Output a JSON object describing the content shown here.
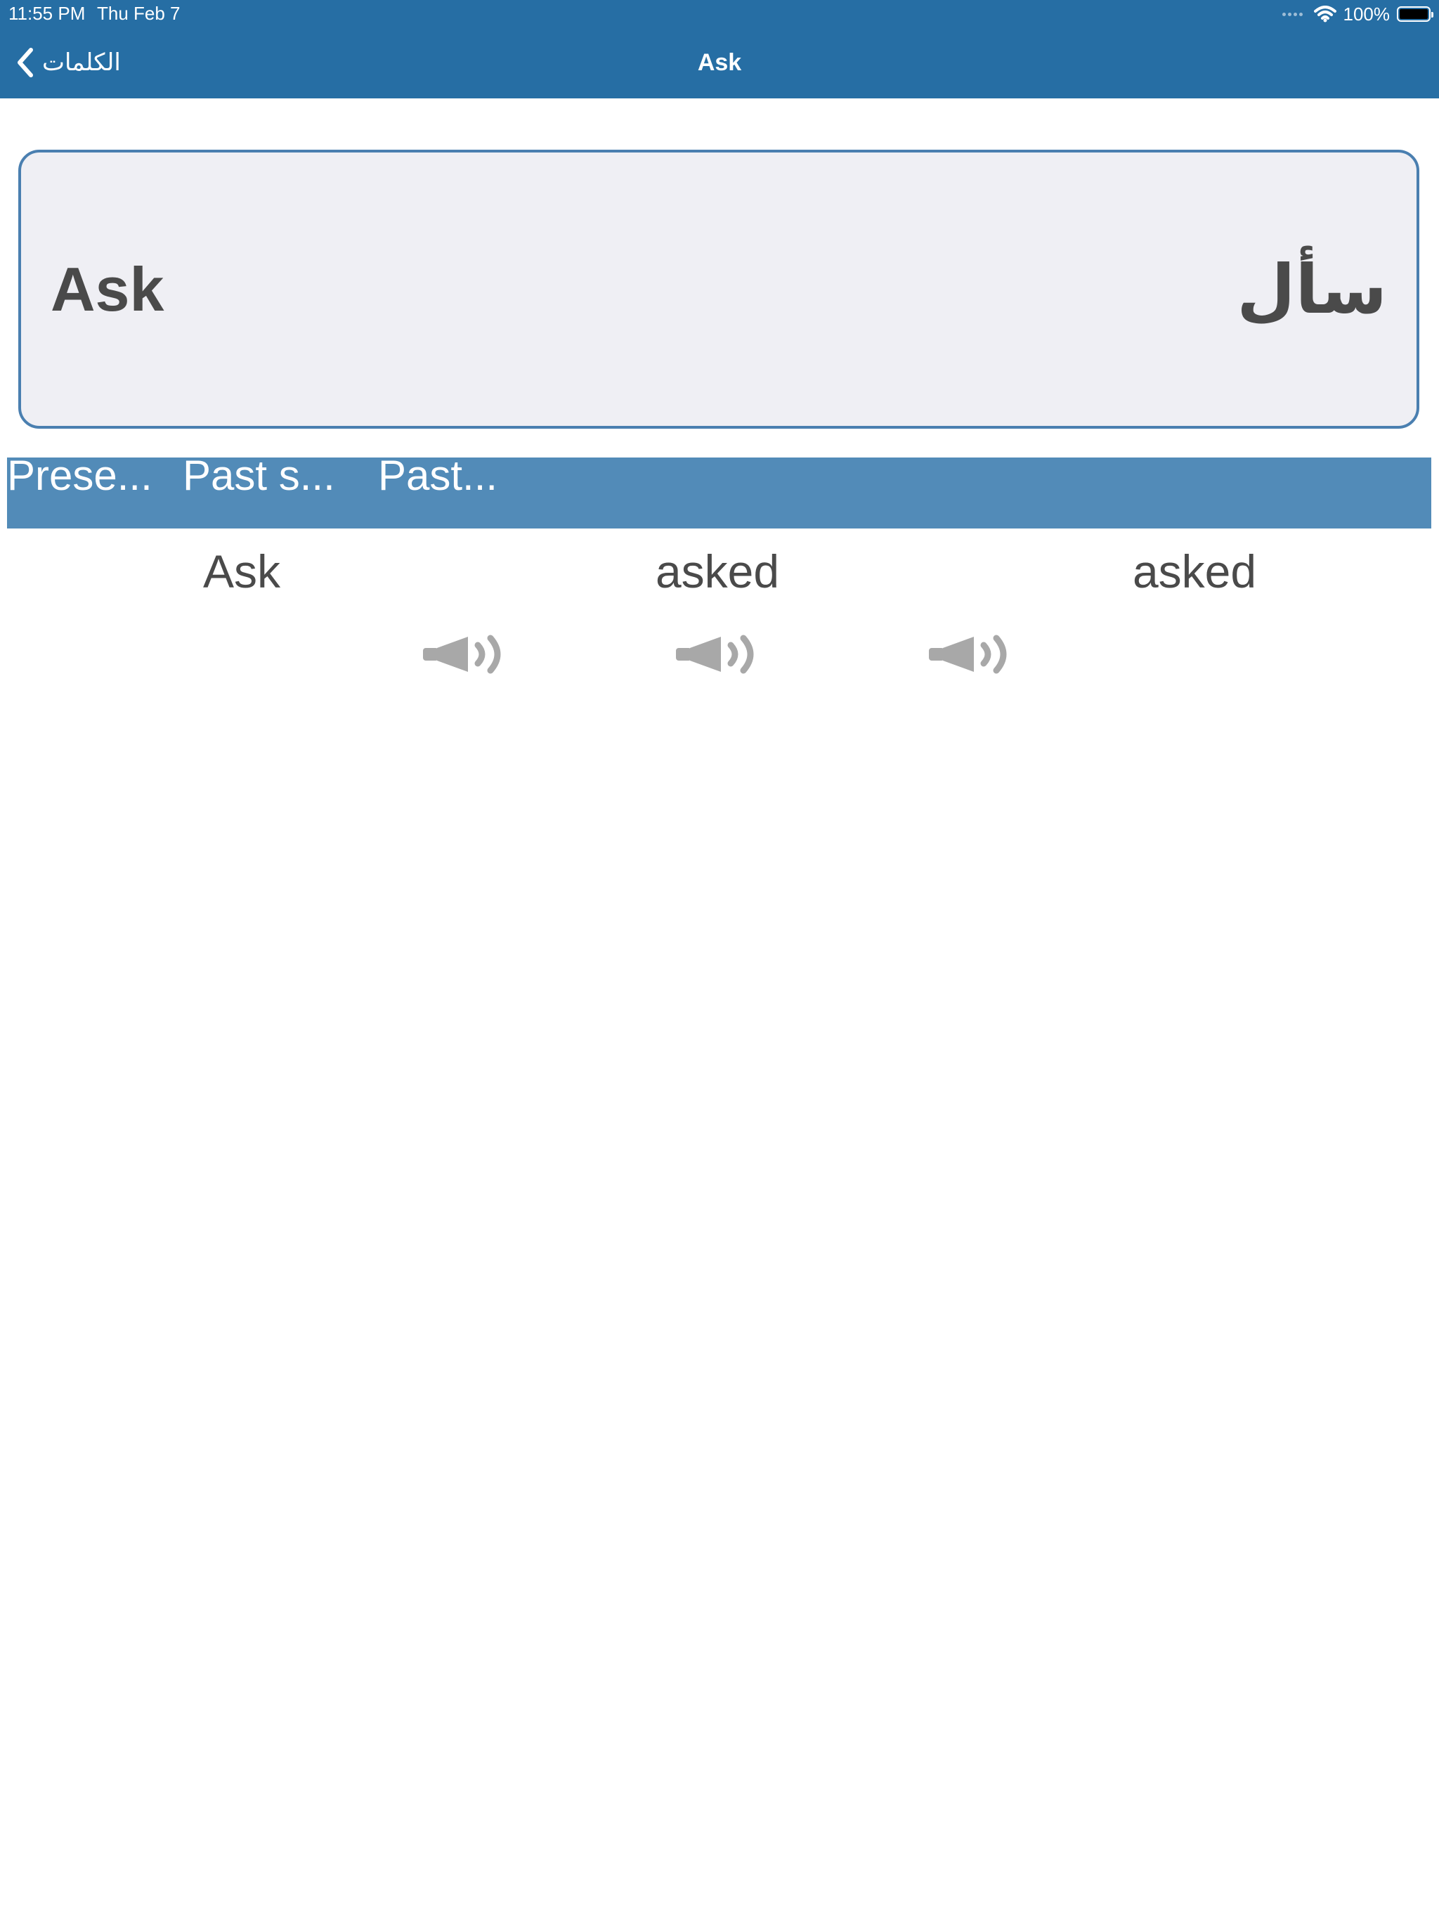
{
  "status_bar": {
    "time": "11:55 PM",
    "date": "Thu Feb 7",
    "battery": "100%"
  },
  "nav": {
    "back_label": "الكلمات",
    "title": "Ask"
  },
  "word": {
    "english": "Ask",
    "arabic": "سأل"
  },
  "tense_headers": [
    "Prese...",
    "Past s...",
    "Past..."
  ],
  "forms": [
    "Ask",
    "asked",
    "asked"
  ],
  "icons": {
    "back": "chevron-left-icon",
    "speaker": "speaker-icon",
    "wifi": "wifi-icon",
    "battery": "battery-icon"
  },
  "colors": {
    "nav_bar": "#266ea4",
    "tense_bar": "#528bb8",
    "card_border": "#4a7fb0",
    "card_bg": "#efeff4",
    "text": "#4a4a4a",
    "icon": "#a8a8a8"
  }
}
